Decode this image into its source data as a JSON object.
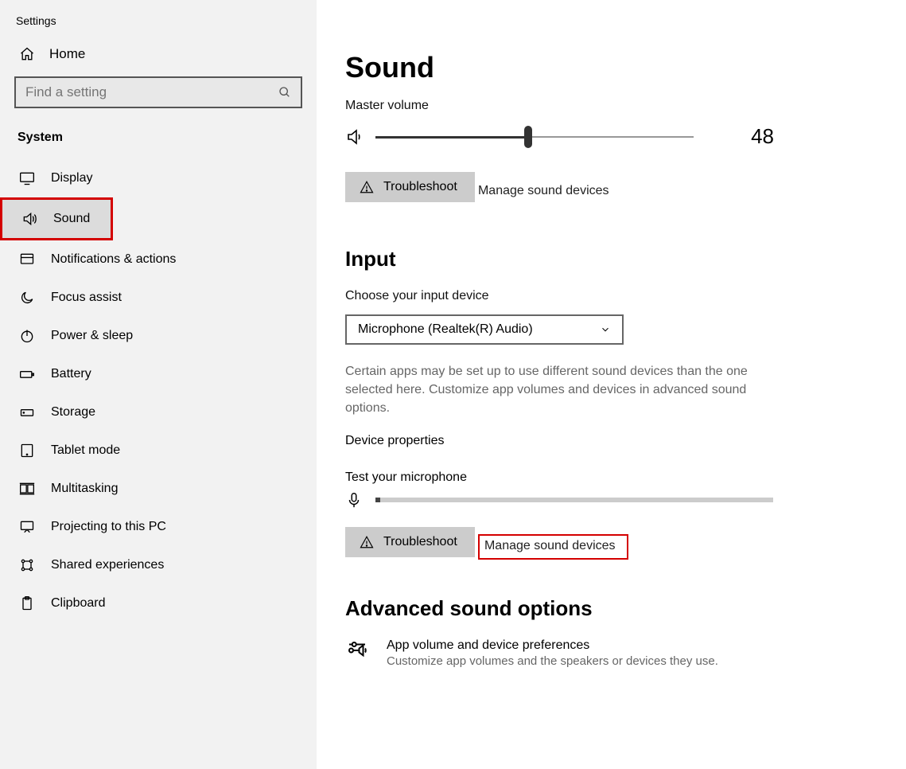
{
  "app": {
    "title": "Settings"
  },
  "sidebar": {
    "home_label": "Home",
    "search_placeholder": "Find a setting",
    "section_label": "System",
    "items": [
      {
        "label": "Display",
        "icon": "monitor-icon"
      },
      {
        "label": "Sound",
        "icon": "speaker-icon",
        "active": true,
        "highlighted": true
      },
      {
        "label": "Notifications & actions",
        "icon": "notification-icon"
      },
      {
        "label": "Focus assist",
        "icon": "moon-icon"
      },
      {
        "label": "Power & sleep",
        "icon": "power-icon"
      },
      {
        "label": "Battery",
        "icon": "battery-icon"
      },
      {
        "label": "Storage",
        "icon": "storage-icon"
      },
      {
        "label": "Tablet mode",
        "icon": "tablet-icon"
      },
      {
        "label": "Multitasking",
        "icon": "multitasking-icon"
      },
      {
        "label": "Projecting to this PC",
        "icon": "projecting-icon"
      },
      {
        "label": "Shared experiences",
        "icon": "shared-icon"
      },
      {
        "label": "Clipboard",
        "icon": "clipboard-icon"
      }
    ]
  },
  "main": {
    "title": "Sound",
    "master_volume_label": "Master volume",
    "volume_value": "48",
    "troubleshoot_label": "Troubleshoot",
    "manage_devices_label": "Manage sound devices",
    "input_heading": "Input",
    "choose_input_label": "Choose your input device",
    "input_device": "Microphone (Realtek(R) Audio)",
    "input_help": "Certain apps may be set up to use different sound devices than the one selected here. Customize app volumes and devices in advanced sound options.",
    "device_properties_label": "Device properties",
    "test_mic_label": "Test your microphone",
    "troubleshoot2_label": "Troubleshoot",
    "manage_devices2_label": "Manage sound devices",
    "advanced_heading": "Advanced sound options",
    "adv_title": "App volume and device preferences",
    "adv_sub": "Customize app volumes and the speakers or devices they use."
  }
}
